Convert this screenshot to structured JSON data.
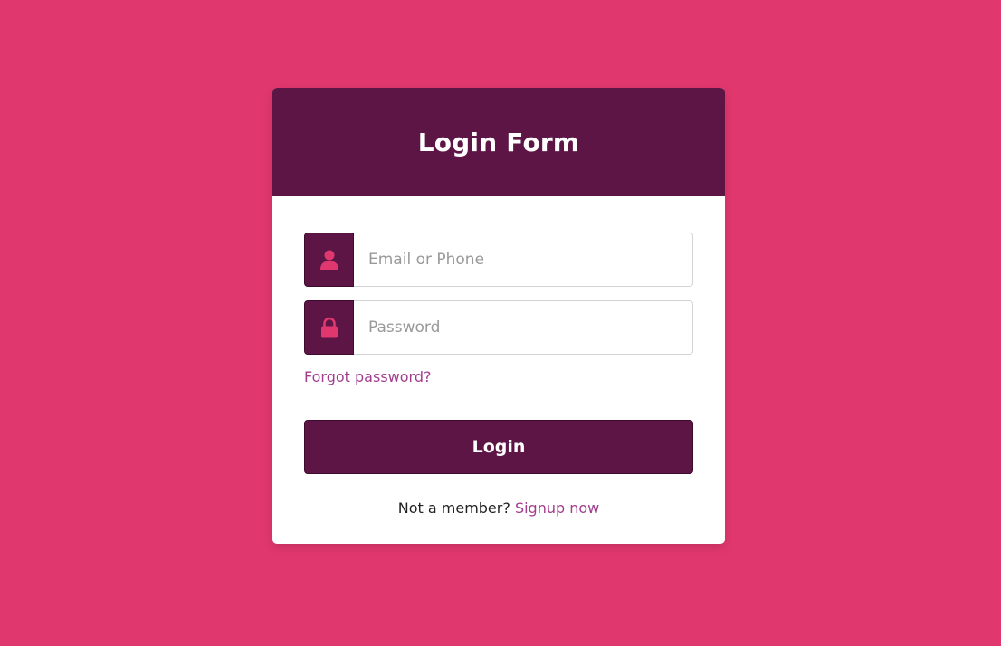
{
  "form": {
    "title": "Login Form",
    "email_placeholder": "Email or Phone",
    "password_placeholder": "Password",
    "forgot_label": "Forgot password?",
    "login_label": "Login",
    "signup_prompt": "Not a member?",
    "signup_label": "Signup now"
  },
  "icons": {
    "email": "user-icon",
    "password": "lock-icon"
  },
  "colors": {
    "background": "#e0376e",
    "header": "#5d1545",
    "icon": "#e0376e",
    "link": "#a23d8e"
  }
}
